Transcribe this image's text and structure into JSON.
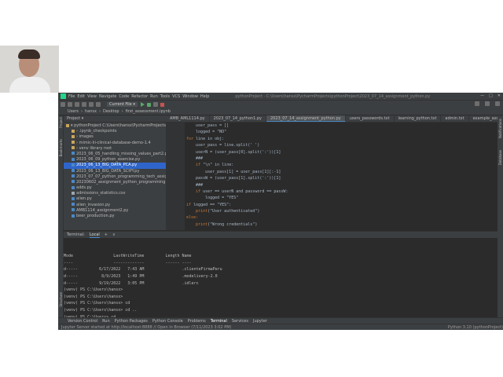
{
  "window": {
    "title": "pythonProject - C:\\Users\\hansx\\PycharmProjects\\pythonProject\\2023_07_14_assignment_python.py",
    "menu": [
      "File",
      "Edit",
      "View",
      "Navigate",
      "Code",
      "Refactor",
      "Run",
      "Tools",
      "VCS",
      "Window",
      "Help"
    ]
  },
  "toolbar": {
    "run_config": "Current File ▾"
  },
  "breadcrumb": [
    "Users",
    "hansx",
    "Desktop",
    "first_assessment.ipynb"
  ],
  "project": {
    "header": "Project ▾",
    "items": [
      {
        "label": "▾ pythonProject  C:\\Users\\hansx\\PycharmProjects\\pythonProject",
        "type": "folder",
        "indent": 0
      },
      {
        "label": "› .ipynb_checkpoints",
        "type": "folder",
        "indent": 1
      },
      {
        "label": "› images",
        "type": "folder",
        "indent": 1
      },
      {
        "label": "› mimic-iii-clinical-database-demo-1.4",
        "type": "folder",
        "indent": 1
      },
      {
        "label": "› venv  library root",
        "type": "folder",
        "indent": 1
      },
      {
        "label": "2023_06_05_handling_missing_values_part2.py",
        "type": "py",
        "indent": 1
      },
      {
        "label": "2023_06_09_python_exercise.py",
        "type": "py",
        "indent": 1
      },
      {
        "label": "2023_06_13_BIG_DATA_PCA.py",
        "type": "py",
        "indent": 1,
        "selected": true
      },
      {
        "label": "2023_06_13_BIG_DATA_SCIPY.py",
        "type": "py",
        "indent": 1
      },
      {
        "label": "2023_07_07_python_programming_tech_assignment.py",
        "type": "py",
        "indent": 1
      },
      {
        "label": "20230602_assignment_python_programming.py",
        "type": "py",
        "indent": 1
      },
      {
        "label": "adds.py",
        "type": "py",
        "indent": 1
      },
      {
        "label": "admissions_statistics.csv",
        "type": "csv",
        "indent": 1
      },
      {
        "label": "alien.py",
        "type": "py",
        "indent": 1
      },
      {
        "label": "alien_invasion.py",
        "type": "py",
        "indent": 1
      },
      {
        "label": "AMB1114_assignment2.py",
        "type": "py",
        "indent": 1
      },
      {
        "label": "beer_production.py",
        "type": "py",
        "indent": 1
      }
    ]
  },
  "editor": {
    "tabs": [
      {
        "label": "AMB_AML1114.py",
        "active": false
      },
      {
        "label": "2023_07_14_python1.py",
        "active": false
      },
      {
        "label": "2023_07_14_assignment_python.py",
        "active": true
      },
      {
        "label": "users_passwords.txt",
        "active": false
      },
      {
        "label": "learning_python.txt",
        "active": false
      },
      {
        "label": "admin.txt",
        "active": false
      },
      {
        "label": "example_assumptions.py",
        "active": false
      }
    ],
    "lines": [
      {
        "n": "",
        "text": "    user_pass = []"
      },
      {
        "n": "",
        "text": "    logged = \"NO\""
      },
      {
        "n": "",
        "text": "for line in obj:"
      },
      {
        "n": "",
        "text": "    user_pass = line.split(' ')"
      },
      {
        "n": "",
        "text": "    userN = (user_pass[0].split(':'))[1]"
      },
      {
        "n": "",
        "text": "    ###"
      },
      {
        "n": "",
        "text": "    if \"\\n\" in line:"
      },
      {
        "n": "",
        "text": "        user_pass[1] = user_pass[1][:-1]"
      },
      {
        "n": "",
        "text": "    passW = (user_pass[1].split(':'))[1]"
      },
      {
        "n": "",
        "text": "    ###"
      },
      {
        "n": "",
        "text": "    if user == userN and password == passW:"
      },
      {
        "n": "",
        "text": "        logged = \"YES\""
      },
      {
        "n": "",
        "text": "if logged == \"YES\":"
      },
      {
        "n": "",
        "text": "    print(\"User authenticated\")"
      },
      {
        "n": "",
        "text": "else:"
      },
      {
        "n": "",
        "text": "    print(\"Wrong credentials\")"
      }
    ]
  },
  "terminal": {
    "tabs": [
      "Terminal:",
      "Local",
      "+",
      "∨"
    ],
    "lines": [
      "",
      "",
      "Mode                 LastWriteTime         Length Name",
      "----                 -------------         ------ ----",
      "d-----         6/17/2022   7:43 AM                .clienteFirmaPeru",
      "d-----          8/9/2023   1:49 PM                .modelivery-2.0",
      "d-----         9/19/2022   3:05 PM                .idlerc",
      "(venv) PS C:\\Users\\hansx>",
      "(venv) PS C:\\Users\\hansx>",
      "(venv) PS C:\\Users\\hansx> cd",
      "(venv) PS C:\\Users\\hansx> cd ..",
      "(venv) PS C:\\Users> cd",
      "(venv) PS C:\\Users>"
    ]
  },
  "bottom_tools": [
    "Version Control",
    "Run",
    "Python Packages",
    "Python Console",
    "Problems",
    "Terminal",
    "Services",
    "Jupyter"
  ],
  "status": {
    "left": "Jupyter Server started at http://localhost:8888 // Open in Browser (7/11/2023 3:02 PM)",
    "right": "Python 3.10 (pythonProject)"
  },
  "side_tabs": {
    "left": [
      "Project",
      "Bookmarks",
      "Structure"
    ],
    "right": [
      "Notifications",
      "Database"
    ]
  },
  "colors": {
    "ide_bg": "#2b2b2b",
    "panel_bg": "#3c3f41",
    "selection": "#2f65ca",
    "keyword": "#cc7832",
    "run_green": "#59a869"
  }
}
